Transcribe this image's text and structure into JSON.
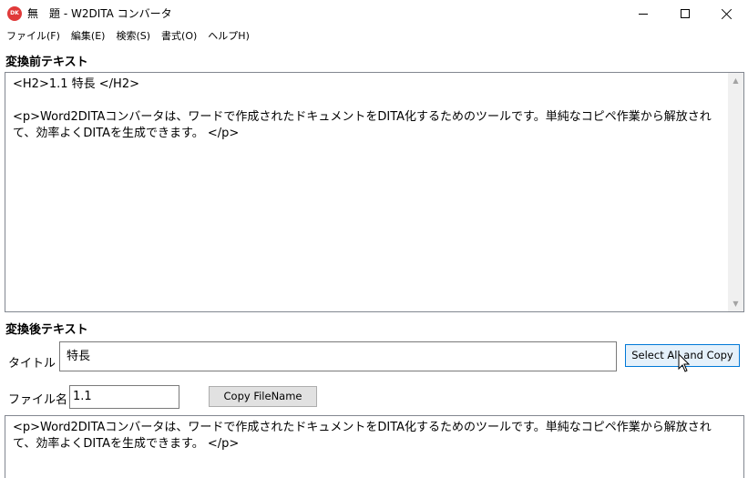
{
  "window": {
    "app_icon_text": "DK",
    "title": "無　題 - W2DITA コンバータ"
  },
  "menu": [
    "ファイル(F)",
    "編集(E)",
    "検索(S)",
    "書式(O)",
    "ヘルプH)"
  ],
  "before": {
    "label": "変換前テキスト",
    "text": "<H2>1.1 特長 </H2>\n\n<p>Word2DITAコンバータは、ワードで作成されたドキュメントをDITA化するためのツールです。単純なコピペ作業から解放されて、効率よくDITAを生成できます。 </p>"
  },
  "after": {
    "label": "変換後テキスト",
    "title_label": "タイトル",
    "title_value": "特長",
    "select_all_button": "Select All and Copy",
    "filename_label": "ファイル名",
    "filename_value": "1.1",
    "copy_filename_button": "Copy FileName",
    "text": "<p>Word2DITAコンバータは、ワードで作成されたドキュメントをDITA化するためのツールです。単純なコピペ作業から解放されて、効率よくDITAを生成できます。 </p>"
  },
  "icons": {
    "app": "w2dita-app-icon",
    "minimize": "minimize-icon",
    "maximize": "maximize-icon",
    "close": "close-icon",
    "scroll_up": "scroll-up-arrow-icon",
    "scroll_down": "scroll-down-arrow-icon",
    "cursor": "mouse-cursor-icon"
  },
  "colors": {
    "app_icon": "#e03a3a",
    "focused_button_border": "#0078d7",
    "focused_button_bg": "#e5f1fb"
  }
}
